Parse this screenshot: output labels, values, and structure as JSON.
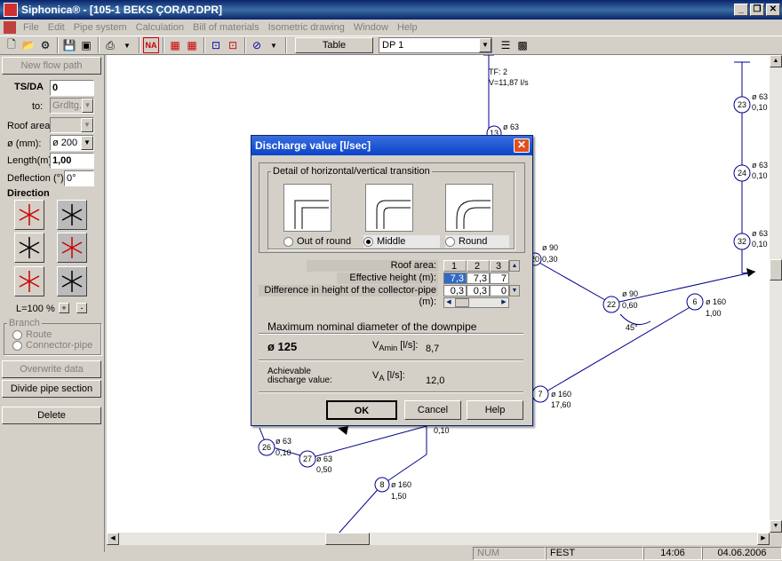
{
  "window": {
    "title": "Siphonica® - [105-1 BEKS ÇORAP.DPR]"
  },
  "menu": [
    "File",
    "Edit",
    "Pipe system",
    "Calculation",
    "Bill of materials",
    "Isometric drawing",
    "Window",
    "Help"
  ],
  "toolbar": {
    "table_label": "Table",
    "dp_value": "DP 1"
  },
  "left": {
    "new_flow_path": "New flow path",
    "tsda_label": "TS/DA",
    "tsda_value": "0",
    "to_label": "to:",
    "to_value": "Grdltg.",
    "roof_label": "Roof area:",
    "roof_value": "",
    "dia_label": "ø (mm):",
    "dia_value": "ø 200",
    "length_label": "Length(m)",
    "length_value": "1,00",
    "defl_label": "Deflection (°):",
    "defl_value": "0°",
    "direction_label": "Direction",
    "l_label": "L=100 %",
    "plus": "+",
    "minus": "-",
    "branch_label": "Branch",
    "route": "Route",
    "connector": "Connector-pipe",
    "overwrite": "Overwrite data",
    "divide": "Divide pipe section",
    "delete": "Delete"
  },
  "drawing": {
    "tf": "TF: 2",
    "v": "V=11,87 l/s",
    "angle": "45°",
    "nodes": [
      {
        "id": "23",
        "d": "ø 63",
        "v": "0,10"
      },
      {
        "id": "24",
        "d": "ø 63",
        "v": "0,10"
      },
      {
        "id": "32",
        "d": "ø 63",
        "v": "0,10"
      },
      {
        "id": "13",
        "d": "ø 63",
        "v": ""
      },
      {
        "id": "20",
        "d": "ø 90",
        "v": "0,30"
      },
      {
        "id": "22",
        "d": "ø 90",
        "v": "0,60"
      },
      {
        "id": "6",
        "d": "ø 160",
        "v": "1,00"
      },
      {
        "id": "7",
        "d": "ø 160",
        "v": "17,60"
      },
      {
        "id": "26",
        "d": "ø 63",
        "v": "0,10"
      },
      {
        "id": "27",
        "d": "ø 63",
        "v": "0,50"
      },
      {
        "id": "8",
        "d": "ø 160",
        "v": "1,50"
      },
      {
        "id": "",
        "d": "",
        "v": "0,10"
      }
    ]
  },
  "dialog": {
    "title": "Discharge value [l/sec]",
    "group": "Detail of horizontal/vertical transition",
    "options": [
      {
        "label": "Out of round",
        "selected": false
      },
      {
        "label": "Middle",
        "selected": true
      },
      {
        "label": "Round",
        "selected": false
      }
    ],
    "row_labels": [
      "Roof area:",
      "Effective height (m):",
      "Difference in height of the collector-pipe (m):"
    ],
    "cols": [
      "1",
      "2",
      "3"
    ],
    "eff": [
      "7,3",
      "7,3",
      "7"
    ],
    "diff": [
      "0,3",
      "0,3",
      "0"
    ],
    "max_label": "Maximum nominal diameter of the downpipe",
    "max_value": "ø 125",
    "vamin_label": "V",
    "vamin_sub": "Amin",
    "vamin_unit": "[l/s]:",
    "vamin_value": "8,7",
    "ach_label1": "Achievable",
    "ach_label2": "discharge value:",
    "va_label": "V",
    "va_sub": "A",
    "va_unit": "[l/s]:",
    "va_value": "12,0",
    "ok": "OK",
    "cancel": "Cancel",
    "help": "Help"
  },
  "status": {
    "num": "NUM",
    "fest": "FEST",
    "time": "14:06",
    "date": "04.06.2006"
  }
}
